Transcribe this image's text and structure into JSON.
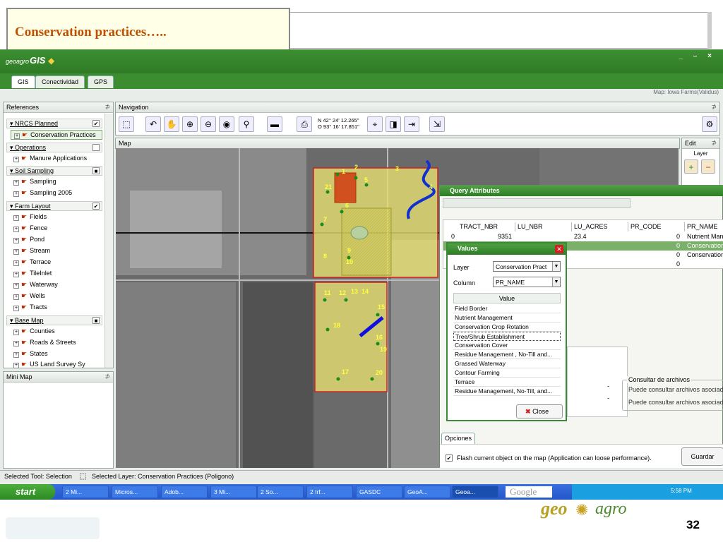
{
  "slide": {
    "title": "Conservation practices…..",
    "page_number": "32",
    "brand_left": "geo",
    "brand_right": "agro"
  },
  "app": {
    "logo_small": "geoagro",
    "logo_big": "GIS",
    "window_controls": "_ – ×",
    "tabs": [
      "GIS",
      "Conectividad",
      "GPS"
    ],
    "map_status": "Map: Iowa Farms(Validus)"
  },
  "references": {
    "title": "References",
    "groups": [
      {
        "label": "NRCS Planned",
        "checked": "✔",
        "items": [
          "Conservation Practices"
        ]
      },
      {
        "label": "Operations",
        "checked": "",
        "items": [
          "Manure Applications"
        ]
      },
      {
        "label": "Soil Sampling",
        "checked": "■",
        "items": [
          "Sampling",
          "Sampling 2005"
        ]
      },
      {
        "label": "Farm Layout",
        "checked": "✔",
        "items": [
          "Fields",
          "Fence",
          "Pond",
          "Stream",
          "Terrace",
          "TileInlet",
          "Waterway",
          "Wells",
          "Tracts"
        ]
      },
      {
        "label": "Base Map",
        "checked": "■",
        "items": [
          "Counties",
          "Roads & Streets",
          "States",
          "US Land Survey Sy"
        ]
      }
    ]
  },
  "mini_map": {
    "title": "Mini Map"
  },
  "navigation": {
    "title": "Navigation",
    "coords_lat": "N 42° 24' 12.265\"",
    "coords_lon": "O 93° 16' 17.851\""
  },
  "map": {
    "title": "Map",
    "labels": [
      "1",
      "2",
      "3",
      "4",
      "5",
      "6",
      "7",
      "8",
      "9",
      "10",
      "11",
      "12",
      "13",
      "14",
      "15",
      "16",
      "17",
      "18",
      "19",
      "20",
      "21"
    ]
  },
  "edit": {
    "title": "Edit",
    "layer_label": "Layer"
  },
  "query": {
    "title": "Query Attributes",
    "columns": [
      "TRACT_NBR",
      "LU_NBR",
      "LU_ACRES",
      "PR_CODE",
      "PR_NAME"
    ],
    "rows": [
      {
        "id": "0",
        "tract": "9351",
        "lu_nbr": "",
        "acres": "23.4",
        "code": "0",
        "name": "Nutrient Mana"
      },
      {
        "id": "",
        "tract": "",
        "lu_nbr": "",
        "acres": "",
        "code": "0",
        "name": "Conservation"
      },
      {
        "id": "",
        "tract": "",
        "lu_nbr": "",
        "acres": "",
        "code": "0",
        "name": "Conservation"
      },
      {
        "id": "",
        "tract": "",
        "lu_nbr": "",
        "acres": "",
        "code": "0",
        "name": ""
      }
    ],
    "consult_title": "Consultar de archivos",
    "consult_line1": "Puede consultar archivos asociado",
    "consult_line2": "Puede consultar archivos asociado",
    "options_tab": "Opciones",
    "flash_label": "Flash current object on the map (Application can loose performance).",
    "save_button": "Guardar",
    "dash1": "-",
    "dash2": "-"
  },
  "values_dialog": {
    "title": "Values",
    "layer_label": "Layer",
    "layer_value": "Conservation Pract",
    "column_label": "Column",
    "column_value": "PR_NAME",
    "value_header": "Value",
    "values": [
      "Field Border",
      "Nutrient Management",
      "Conservation Crop Rotation",
      "Tree/Shrub Establishment",
      "Conservation Cover",
      "Residue Management , No-Till and...",
      "Grassed Waterway",
      "Contour Farming",
      "Terrace",
      "Residue Management, No-Till, and..."
    ],
    "selected_value": "Tree/Shrub Establishment",
    "close_button": "Close"
  },
  "status": {
    "tool": "Selected Tool: Selection",
    "layer": "Selected Layer: Conservation Practices (Poligono)"
  },
  "taskbar": {
    "start": "start",
    "tasks": [
      "2 Mi...",
      "Micros...",
      "Adob...",
      "3 Mi...",
      "2 So...",
      "2 Irf...",
      "GASDC",
      "GeoA...",
      "Geoa..."
    ],
    "search": "Google",
    "clock": "5:58 PM"
  },
  "colors": {
    "accent_green": "#3b8d30",
    "title_orange": "#c05000",
    "brand_gold": "#b8a020"
  }
}
